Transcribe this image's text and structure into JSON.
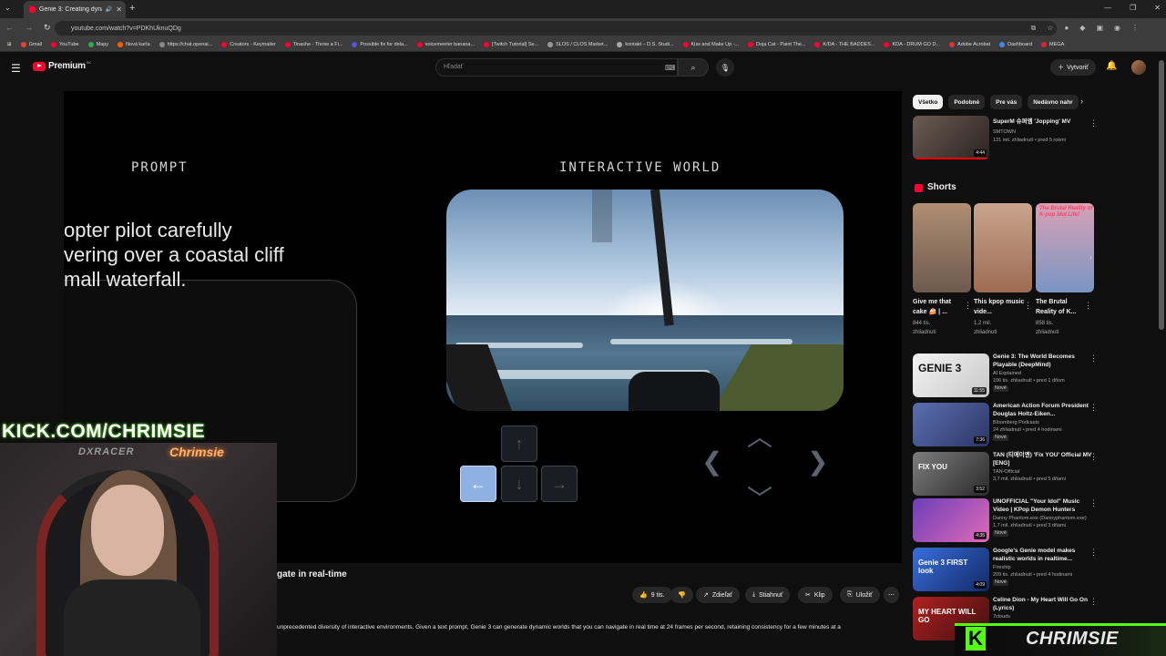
{
  "browser": {
    "tab_title": "Genie 3: Creating dynamic",
    "new_tab": "+",
    "url": "youtube.com/watch?v=PDKhUknuQDg",
    "bookmarks": [
      "Gmail",
      "YouTube",
      "Mapy",
      "Nová karta",
      "https://chat.openai...",
      "Creators - Keymailer",
      "Tinashe - Throw a Fi...",
      "Possible fix for dela...",
      "voicemeeter banana...",
      "[Twitch Tutorial] Se...",
      "SLOS / CLOS Market...",
      "kontakt – D.S. Studi...",
      "Kiss and Make Up -...",
      "Doja Cat - Paint The...",
      "K/DA - THE BADDES...",
      "KDA - DRUM GO D...",
      "Adobe Acrobat",
      "Dashboard",
      "MEGA"
    ]
  },
  "youtube": {
    "logo_text": "Premium",
    "logo_region": "SK",
    "search_placeholder": "Hľadať",
    "create_label": "Vytvoriť"
  },
  "video": {
    "prompt_label": "PROMPT",
    "world_label": "INTERACTIVE WORLD",
    "prompt_lines": [
      "opter pilot carefully",
      "vering over a coastal cliff",
      "mall waterfall."
    ],
    "keys": {
      "up": "↑",
      "left": "←",
      "down": "↓",
      "right": "→"
    }
  },
  "webcam": {
    "kick_url": "KICK.COM/CHRIMSIE",
    "chair_brand": "DXRACER",
    "neon_sign": "Chrimsie"
  },
  "below_video": {
    "title_fragment": "gate in real-time",
    "likes": "9 tis.",
    "share": "Zdieľať",
    "download": "Stiahnuť",
    "clip": "Klip",
    "save": "Uložiť",
    "description": "unprecedented diversity of interactive environments. Given a text prompt, Genie 3 can generate dynamic worlds that you can navigate in real time at 24 frames per second, retaining consistency for a few minutes at a"
  },
  "sidebar": {
    "chips": [
      "Všetko",
      "Podobné",
      "Pre vás",
      "Nedávno nahr"
    ],
    "first_video": {
      "title": "SuperM 슈퍼엠 'Jopping' MV",
      "channel": "SMTOWN",
      "meta": "131 mil. zhliadnutí • pred 5 rokmi",
      "duration": "4:44"
    },
    "shorts_label": "Shorts",
    "shorts": [
      {
        "title": "Give me that cake 🍰 | ...",
        "views": "844 tis.",
        "views2": "zhliadnutí"
      },
      {
        "title": "This kpop music vide...",
        "views": "1,2 mil.",
        "views2": "zhliadnutí"
      },
      {
        "title": "The Brutal Reality of K...",
        "views": "858 tis.",
        "views2": "zhliadnutí",
        "overlay": "The Brutal Reality of K-pop Idol Life!"
      }
    ],
    "videos": [
      {
        "title": "Genie 3: The World Becomes Playable (DeepMind)",
        "channel": "AI Explained",
        "meta": "106 tis. zhliadnutí • pred 1 dňom",
        "badge": "Nové",
        "duration": "11:55",
        "thumb_text": "GENIE 3"
      },
      {
        "title": "American Action Forum President Douglas Holtz-Eiken...",
        "channel": "Bloomberg Podcasts",
        "meta": "24 zhliadnutí • pred 4 hodinami",
        "badge": "Nové",
        "duration": "7:36",
        "thumb_text": ""
      },
      {
        "title": "TAN (티에이엔) 'Fix YOU' Official MV [ENG]",
        "channel": "TAN-Official",
        "meta": "3,7 mil. zhliadnutí • pred 5 dňami",
        "badge": "",
        "duration": "3:52",
        "thumb_text": "FIX YOU"
      },
      {
        "title": "UNOFFICIAL \"Your Idol\" Music Video | KPop Demon Hunters",
        "channel": "Danny Phantom.exe (Dannyphantom.exe)",
        "meta": "1,7 mil. zhliadnutí • pred 3 dňami",
        "badge": "Nové",
        "duration": "4:35",
        "thumb_text": ""
      },
      {
        "title": "Google's Genie model makes realistic worlds in realtime...",
        "channel": "Fireship",
        "meta": "209 tis. zhliadnutí • pred 4 hodinami",
        "badge": "Nové",
        "duration": "4:09",
        "thumb_text": "Genie 3 FIRST look"
      },
      {
        "title": "Celine Dion - My Heart Will Go On (Lyrics)",
        "channel": "7clouds",
        "meta": "",
        "badge": "",
        "duration": "",
        "thumb_text": "MY HEART WILL GO"
      }
    ]
  },
  "overlay": {
    "kick_letter": "K",
    "channel_name": "CHRIMSIE"
  }
}
